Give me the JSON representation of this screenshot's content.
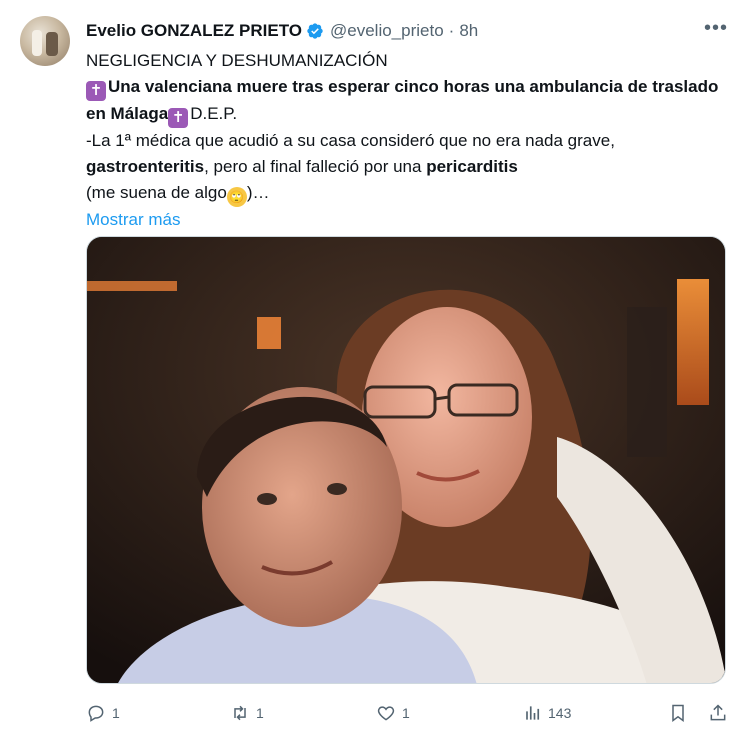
{
  "author": {
    "name": "Evelio GONZALEZ PRIETO",
    "handle": "@evelio_prieto",
    "separator": "·",
    "time": "8h"
  },
  "icons": {
    "verified": "verified-badge-icon",
    "more": "more-options-icon",
    "cross": "latin-cross-emoji",
    "rolling_eyes": "face-with-rolling-eyes-emoji"
  },
  "text": {
    "line1": "NEGLIGENCIA Y DESHUMANIZACIÓN",
    "headline_bold": "Una valenciana muere tras esperar cinco horas una ambulancia de traslado en Málaga",
    "dep": "D.E.P.",
    "line3a": "-La 1ª médica que acudió a su casa consideró que no era nada grave,",
    "line4_bold1": "gastroenteritis",
    "line4_mid": ", pero al final falleció por una ",
    "line4_bold2": "pericarditis",
    "line5a": "(me suena de algo",
    "line5b": ")…",
    "show_more": "Mostrar más"
  },
  "actions": {
    "reply_count": "1",
    "retweet_count": "1",
    "like_count": "1",
    "views_count": "143"
  },
  "colors": {
    "accent": "#1d9bf0",
    "verified": "#1d9bf0",
    "muted": "#536471",
    "text": "#0f1419"
  }
}
